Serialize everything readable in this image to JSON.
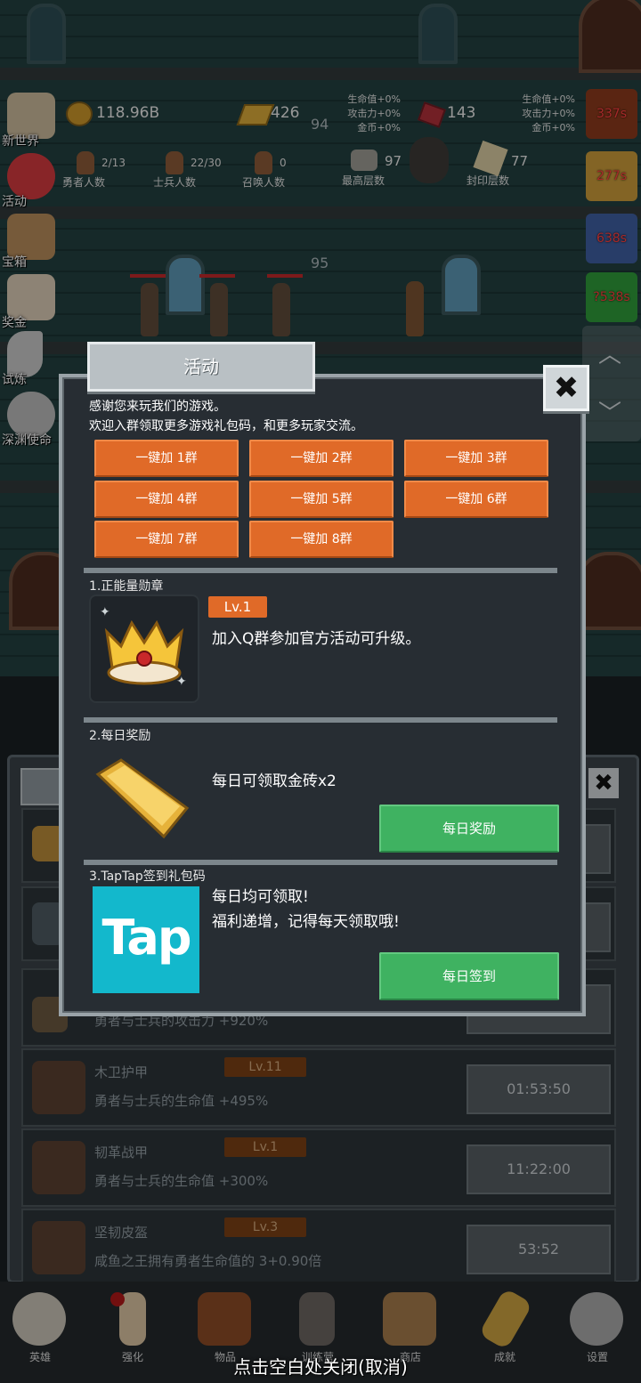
{
  "top_stats": {
    "gold": "118.96B",
    "gold_bars": "426",
    "gems": "143",
    "floor_marker_top": "94",
    "floor_marker_mid": "95",
    "bonus_left": {
      "hp": "生命值+0%",
      "atk": "攻击力+0%",
      "gold": "金币+0%"
    },
    "bonus_right": {
      "hp": "生命值+0%",
      "atk": "攻击力+0%",
      "gold": "金币+0%"
    },
    "heroes": {
      "value": "2/13",
      "label": "勇者人数"
    },
    "soldiers": {
      "value": "22/30",
      "label": "士兵人数"
    },
    "summons": {
      "value": "0",
      "label": "召唤人数"
    },
    "max_floor": {
      "value": "97",
      "label": "最高层数"
    },
    "seal_floor": {
      "value": "77",
      "label": "封印层数"
    }
  },
  "side_menu": [
    {
      "label": "新世界",
      "icon": "scroll-map-icon"
    },
    {
      "label": "活动",
      "icon": "heart-icon"
    },
    {
      "label": "宝箱",
      "icon": "treasure-chest-icon"
    },
    {
      "label": "奖金",
      "icon": "envelope-icon"
    },
    {
      "label": "试炼",
      "icon": "feather-icon"
    },
    {
      "label": "深渊使命",
      "icon": "orb-icon"
    }
  ],
  "timers": [
    "337s",
    "277s",
    "638s",
    "?538s"
  ],
  "dialog": {
    "title": "活动",
    "close": "✖",
    "intro_line1": "感谢您来玩我们的游戏。",
    "intro_line2": "欢迎入群领取更多游戏礼包码，和更多玩家交流。",
    "group_buttons": [
      "一键加 1群",
      "一键加 2群",
      "一键加 3群",
      "一键加 4群",
      "一键加 5群",
      "一键加 6群",
      "一键加 7群",
      "一键加 8群"
    ],
    "section1": {
      "heading": "1.正能量勋章",
      "level": "Lv.1",
      "text": "加入Q群参加官方活动可升级。"
    },
    "section2": {
      "heading": "2.每日奖励",
      "text": "每日可领取金砖x2",
      "button": "每日奖励"
    },
    "section3": {
      "heading": "3.TapTap签到礼包码",
      "text1": "每日均可领取!",
      "text2": "福利递增，记得每天领取哦!",
      "button": "每日签到",
      "logo_text": "Tap"
    }
  },
  "list_rows": [
    {
      "name": "",
      "level": "",
      "desc": "勇者与士兵的攻击力 +920%",
      "timer": ""
    },
    {
      "name": "木卫护甲",
      "level": "Lv.11",
      "desc": "勇者与士兵的生命值 +495%",
      "timer": "01:53:50"
    },
    {
      "name": "韧革战甲",
      "level": "Lv.1",
      "desc": "勇者与士兵的生命值 +300%",
      "timer": "11:22:00"
    },
    {
      "name": "坚韧皮盔",
      "level": "Lv.3",
      "desc": "咸鱼之王拥有勇者生命值的 3+0.90倍",
      "timer": "53:52"
    }
  ],
  "nav": [
    {
      "label": "英雄",
      "icon": "skull-icon"
    },
    {
      "label": "强化",
      "icon": "candle-icon"
    },
    {
      "label": "物品",
      "icon": "book-icon"
    },
    {
      "label": "训练营",
      "icon": "lantern-icon"
    },
    {
      "label": "商店",
      "icon": "beer-mug-icon"
    },
    {
      "label": "成就",
      "icon": "key-icon"
    },
    {
      "label": "设置",
      "icon": "gear-icon"
    }
  ],
  "close_hint": "点击空白处关闭(取消)",
  "colors": {
    "accent_orange": "#e06a28",
    "green": "#3fb261",
    "tap_cyan": "#13b8cc"
  }
}
